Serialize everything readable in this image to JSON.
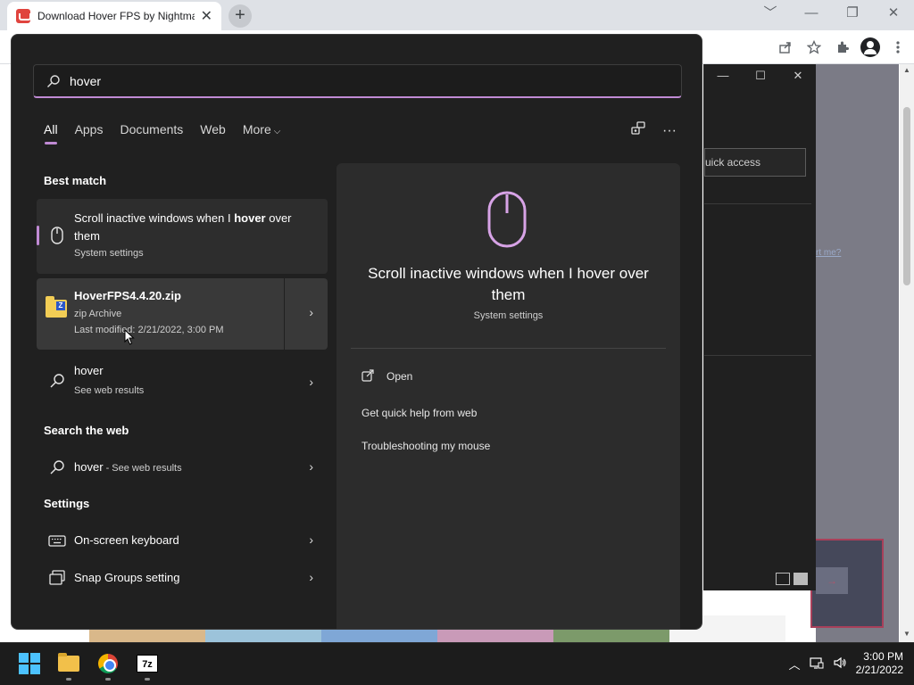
{
  "browser": {
    "tab_title": "Download Hover FPS by Nightmare",
    "tab_close": "✕",
    "new_tab": "+",
    "window_controls": [
      "﹀",
      "—",
      "❐",
      "✕"
    ]
  },
  "explorer": {
    "controls": [
      "—",
      "☐",
      "✕"
    ],
    "search_placeholder": "uick access"
  },
  "background": {
    "link_fragment": "rt me?",
    "arrow_text": "→"
  },
  "search": {
    "query": "hover",
    "tabs": [
      "All",
      "Apps",
      "Documents",
      "Web",
      "More"
    ],
    "active_tab": "All",
    "more_chevron": "⌵",
    "actions_icons": [
      "share-screen-icon",
      "more-icon"
    ],
    "more_glyph": "···"
  },
  "sections": {
    "best_match": "Best match",
    "search_the_web": "Search the web",
    "settings": "Settings"
  },
  "results": {
    "best": {
      "title_prefix": "Scroll inactive windows when I ",
      "title_bold": "hover",
      "title_suffix": " over them",
      "subtitle": "System settings"
    },
    "zip": {
      "name": "HoverFPS4.4.20.zip",
      "type": "zip Archive",
      "modified": "Last modified: 2/21/2022, 3:00 PM",
      "arrow": "›"
    },
    "web": {
      "title": "hover",
      "subtitle": "See web results",
      "arrow": "›"
    },
    "web2": {
      "title": "hover",
      "suffix": " - See web results",
      "arrow": "›"
    },
    "keyboard": {
      "title": "On-screen keyboard",
      "arrow": "›"
    },
    "snap": {
      "title": "Snap Groups setting",
      "arrow": "›"
    }
  },
  "preview": {
    "title": "Scroll inactive windows when I hover over them",
    "subtitle": "System settings",
    "actions": [
      "Open",
      "Get quick help from web",
      "Troubleshooting my mouse"
    ]
  },
  "taskbar": {
    "apps": [
      "start-button",
      "file-explorer",
      "chrome",
      "7zip"
    ],
    "sevenzip_label": "7z",
    "tray_chevron": "︿",
    "time": "3:00 PM",
    "date": "2/21/2022"
  },
  "colors": {
    "accent": "#c08ad4",
    "flyout_bg": "#202020",
    "preview_bg": "#2c2c2c",
    "taskbar_bg": "#1c1c1c"
  }
}
